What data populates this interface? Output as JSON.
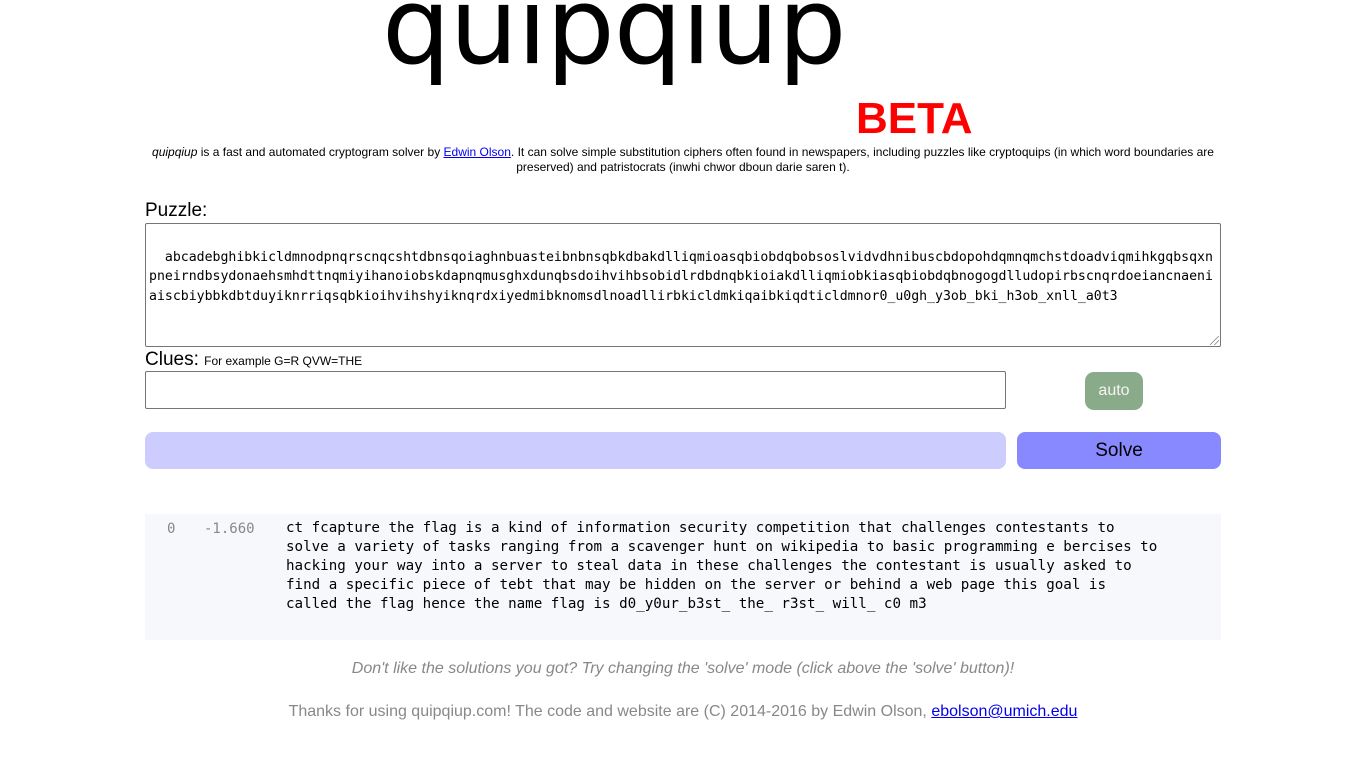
{
  "logo": {
    "main": "quipqiup",
    "badge": "BETA"
  },
  "intro": {
    "app_name": "quipqiup",
    "text_a": " is a fast and automated cryptogram solver by ",
    "author_link": "Edwin Olson",
    "text_b": ". It can solve simple substitution ciphers often found in newspapers, including puzzles like cryptoquips (in which word boundaries are preserved) and patristocrats (inwhi chwor dboun darie saren t)."
  },
  "puzzle": {
    "label": "Puzzle:",
    "value": "abcadebghibkicldmnodpnqrscnqcshtdbnsqoiaghnbuasteibnbnsqbkdbakdlliqmioasqbiobdqbobsoslvidvdhnibuscbdopohdqmnqmchstdoadviqmihkgqbsqxnpneirndbsydonaehsmhdttnqmiyihanoiobskdapnqmusghxdunqbsdoihvihbsobidlrdbdnqbkioiakdlliqmiobkiasqbiobdqbnogogdlludopirbscnqrdoeiancnaeniaiscbiybbkdbtduyiknrriqsqbkioihvihshyiknqrdxiyedmibknomsdlnoadllirbkicldmkiqaibkiqdticldmnor0_u0gh_y3ob_bki_h3ob_xnll_a0t3"
  },
  "clues": {
    "label": "Clues: ",
    "hint": "For example G=R QVW=THE",
    "value": ""
  },
  "buttons": {
    "auto": "auto",
    "solve": "Solve"
  },
  "results": [
    {
      "rank": "0",
      "score": "-1.660",
      "text": "ct fcapture the flag is a kind of information security competition that challenges contestants to\nsolve a variety of tasks ranging from a scavenger hunt on wikipedia to basic programming e bercises to\nhacking your way into a server to steal data in these challenges the contestant is usually asked to\nfind a specific piece of tebt that may be hidden on the server or behind a web page this goal is\ncalled the flag hence the name flag is d0_y0ur_b3st_ the_ r3st_ will_ c0 m3"
    }
  ],
  "tip": "Don't like the solutions you got? Try changing the 'solve' mode (click above the 'solve' button)!",
  "footer": {
    "text": "Thanks for using quipqiup.com! The code and website are (C) 2014-2016 by Edwin Olson, ",
    "email": "ebolson@umich.edu"
  },
  "colors": {
    "badge": "#ff0000",
    "auto_button": "#8aab8a",
    "solve_button": "#8888ff",
    "progress_bar": "#ccccff",
    "results_bg": "#f7f8fc",
    "muted_text": "#888888",
    "link": "#0000ee"
  }
}
